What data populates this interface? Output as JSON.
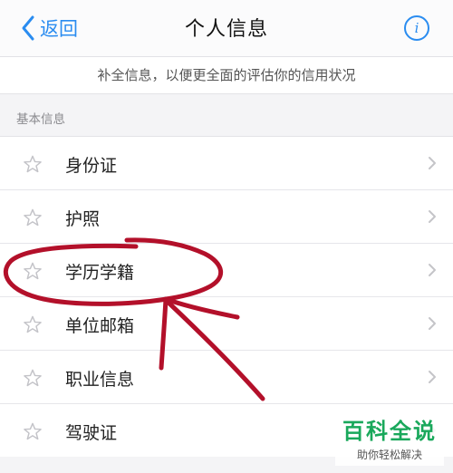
{
  "navbar": {
    "back_label": "返回",
    "title": "个人信息",
    "info_icon": "info-icon"
  },
  "hint": "补全信息，以便更全面的评估你的信用状况",
  "section": {
    "title": "基本信息"
  },
  "items": [
    {
      "label": "身份证",
      "icon": "star-outline-icon"
    },
    {
      "label": "护照",
      "icon": "star-outline-icon"
    },
    {
      "label": "学历学籍",
      "icon": "star-outline-icon"
    },
    {
      "label": "单位邮箱",
      "icon": "star-outline-icon"
    },
    {
      "label": "职业信息",
      "icon": "star-outline-icon"
    },
    {
      "label": "驾驶证",
      "icon": "star-outline-icon"
    }
  ],
  "colors": {
    "accent": "#2a8cf0",
    "annotation": "#b3102a",
    "watermark": "#19a85b"
  },
  "watermark": {
    "title": "百科全说",
    "subtitle": "助你轻松解决"
  }
}
